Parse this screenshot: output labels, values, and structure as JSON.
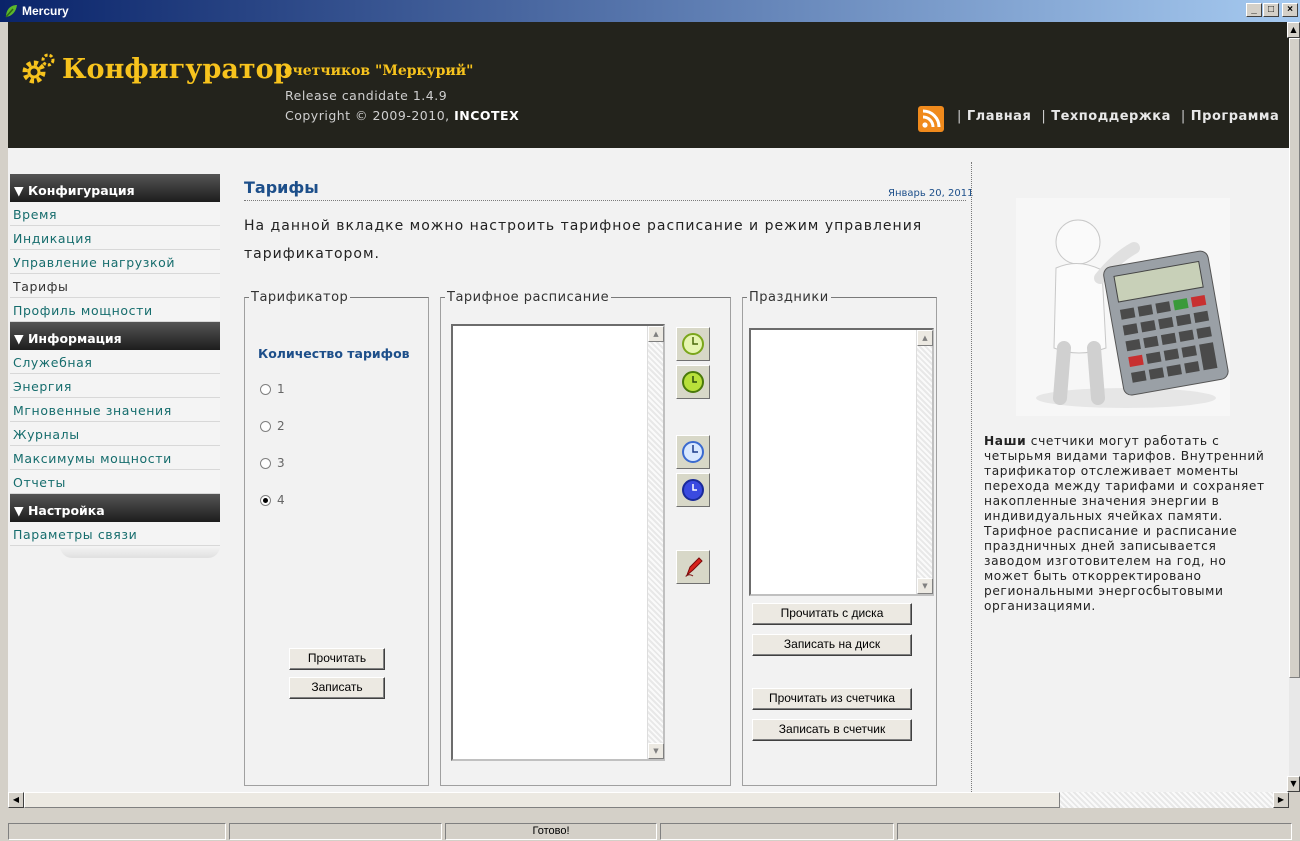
{
  "window": {
    "title": "Mercury"
  },
  "header": {
    "brand": "Конфигуратор",
    "subtitle": "счетчиков \"Меркурий\"",
    "release": "Release candidate 1.4.9",
    "copyright_prefix": "Copyright © 2009-2010, ",
    "copyright_company": "INCOTEX",
    "nav": [
      "Главная",
      "Техподдержка",
      "Программа"
    ]
  },
  "sidebar": {
    "sections": [
      {
        "title": "▼ Конфигурация",
        "items": [
          "Время",
          "Индикация",
          "Управление нагрузкой",
          "Тарифы",
          "Профиль мощности"
        ]
      },
      {
        "title": "▼ Информация",
        "items": [
          "Служебная",
          "Энергия",
          "Мгновенные значения",
          "Журналы",
          "Максимумы мощности",
          "Отчеты"
        ]
      },
      {
        "title": "▼ Настройка",
        "items": [
          "Параметры связи"
        ]
      }
    ],
    "active_item": "Тарифы"
  },
  "main": {
    "title": "Тарифы",
    "date": "Январь 20, 2011",
    "intro": "На данной вкладке можно настроить тарифное расписание и режим управления тарификатором.",
    "tarifikator": {
      "legend": "Тарификатор",
      "count_label": "Количество тарифов",
      "options": [
        "1",
        "2",
        "3",
        "4"
      ],
      "selected": "4",
      "read_label": "Прочитать",
      "write_label": "Записать"
    },
    "schedule": {
      "legend": "Тарифное расписание"
    },
    "holidays": {
      "legend": "Праздники",
      "read_disk": "Прочитать с диска",
      "write_disk": "Записать на диск",
      "read_meter": "Прочитать из счетчика",
      "write_meter": "Записать в счетчик"
    }
  },
  "aside": {
    "text_bold": "Наши",
    "text": " счетчики могут работать с четырьмя видами тарифов. Внутренний тарификатор отслеживает моменты перехода между тарифами и сохраняет накопленные значения энергии в индивидуальных ячейках памяти. Тарифное расписание и расписание праздничных дней записывается заводом изготовителем на год, но может быть откорректировано региональными энергосбытовыми организациями."
  },
  "statusbar": {
    "message": "Готово!"
  },
  "colors": {
    "header_bg": "#23231c",
    "brand": "#f7c31d",
    "link": "#166d6d",
    "title": "#1d4f8a"
  }
}
